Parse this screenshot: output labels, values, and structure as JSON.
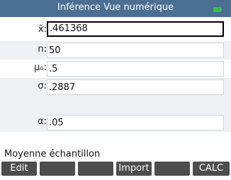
{
  "header": {
    "title": "Inférence Vue numérique"
  },
  "fields": [
    {
      "label": "x̄:",
      "value": ".461368",
      "selected": true
    },
    {
      "label": "n:",
      "value": "50"
    },
    {
      "label": "μ₀:",
      "value": ".5"
    },
    {
      "label": "σ:",
      "value": ".2887"
    },
    {
      "label": "α:",
      "value": ".05"
    }
  ],
  "status": {
    "text": "Moyenne échantillon"
  },
  "menu": {
    "items": [
      "Edit",
      "",
      "",
      "Import",
      "",
      "CALC"
    ]
  },
  "colors": {
    "titlebar": "#4b6e93",
    "softkey": "#4d4d4d",
    "battery": "#3fbf3f"
  }
}
